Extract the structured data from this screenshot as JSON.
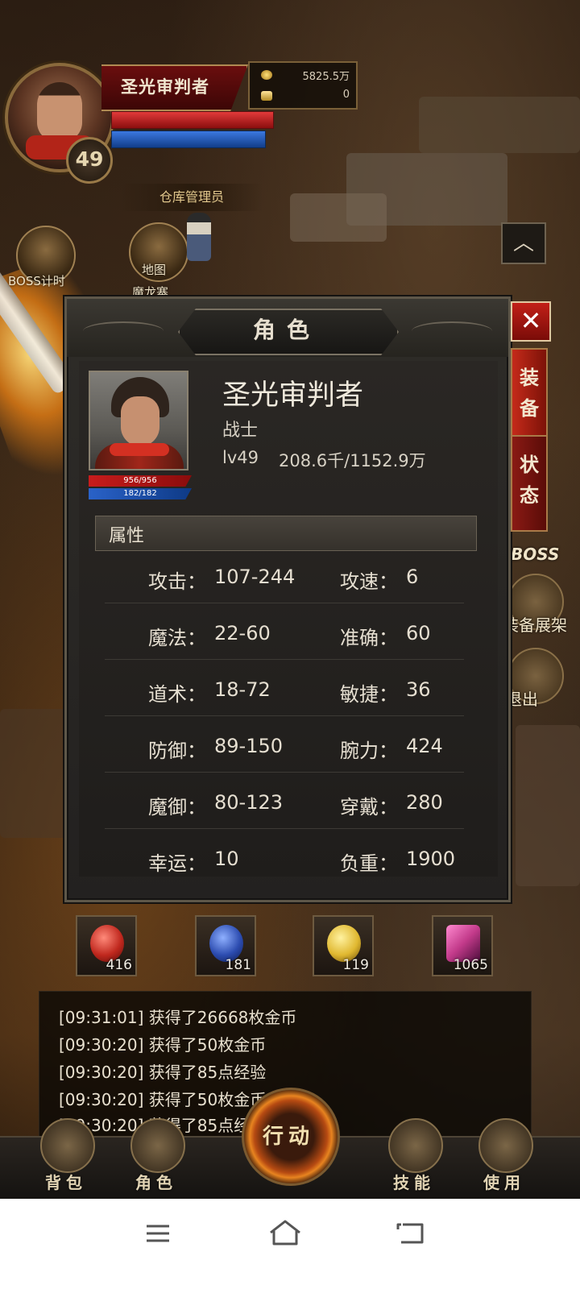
{
  "hud": {
    "player_name": "圣光审判者",
    "level": "49",
    "gold": "5825.5万",
    "ingots": "0",
    "warehouse_label": "仓库管理员"
  },
  "map_shortcuts": [
    {
      "label": "地图",
      "icon": "scroll-map-icon"
    },
    {
      "label": "魔龙寨",
      "icon": "location-icon"
    }
  ],
  "timer_label": "BOSS计时",
  "right_menu": {
    "boss_label": "BOSS",
    "equip_show_label": "装备展架",
    "exit_label": "退出"
  },
  "panel": {
    "title": "角色",
    "close_label": "✕",
    "tabs": [
      {
        "label": "装\n备",
        "active": true
      },
      {
        "label": "状\n态",
        "active": false
      }
    ],
    "character": {
      "name": "圣光审判者",
      "class": "战士",
      "level": "lv49",
      "exp": "208.6千/1152.9万",
      "hp": "956/956",
      "mp": "182/182"
    },
    "attributes_title": "属性",
    "attributes": [
      {
        "left_label": "攻击：",
        "left_value": "107-244",
        "right_label": "攻速：",
        "right_value": "6"
      },
      {
        "left_label": "魔法：",
        "left_value": "22-60",
        "right_label": "准确：",
        "right_value": "60"
      },
      {
        "left_label": "道术：",
        "left_value": "18-72",
        "right_label": "敏捷：",
        "right_value": "36"
      },
      {
        "left_label": "防御：",
        "left_value": "89-150",
        "right_label": "腕力：",
        "right_value": "424"
      },
      {
        "left_label": "魔御：",
        "left_value": "80-123",
        "right_label": "穿戴：",
        "right_value": "280"
      },
      {
        "left_label": "幸运：",
        "left_value": "10",
        "right_label": "负重：",
        "right_value": "1900"
      }
    ]
  },
  "consumables": [
    {
      "name": "red-potion-icon",
      "count": "416",
      "color": "#c0281e"
    },
    {
      "name": "blue-potion-icon",
      "count": "181",
      "color": "#2c4cb0"
    },
    {
      "name": "sun-water-icon",
      "count": "119",
      "color": "#e0b830"
    },
    {
      "name": "scroll-chest-icon",
      "count": "1065",
      "color": "#c23a8a"
    }
  ],
  "log": [
    "[09:31:01] 获得了26668枚金币",
    "[09:30:20] 获得了50枚金币",
    "[09:30:20] 获得了85点经验",
    "[09:30:20] 获得了50枚金币",
    "[09:30:20] 获得了85点经验"
  ],
  "bottom_nav": {
    "bag": "背包",
    "character": "角色",
    "action": "行动",
    "skills": "技能",
    "use": "使用"
  },
  "system_nav": [
    "menu-icon",
    "home-icon",
    "back-icon"
  ]
}
